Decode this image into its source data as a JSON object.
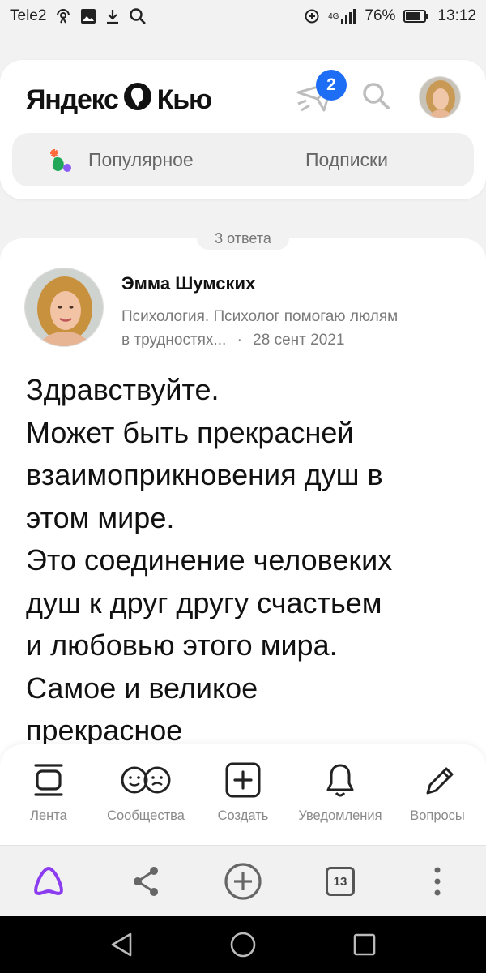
{
  "status_bar": {
    "carrier": "Tele2",
    "network": "4G",
    "battery": "76%",
    "time": "13:12",
    "icons": [
      "radio-icon",
      "image-icon",
      "download-icon",
      "search-icon",
      "data-saver-icon",
      "signal-icon",
      "battery-icon"
    ]
  },
  "header": {
    "logo_left": "Яндекс",
    "logo_right": "Кью",
    "notifications_count": "2",
    "tabs": [
      {
        "label": "Популярное",
        "icon": "flame-icon"
      },
      {
        "label": "Подписки"
      }
    ]
  },
  "answer": {
    "answers_count": "3 ответа",
    "author": {
      "name": "Эмма Шумских",
      "bio": "Психология. Психолог помогаю люлям",
      "bio_cont": "в трудностях...",
      "separator": "·",
      "date": "28 сент 2021"
    },
    "text_lines": [
      "Здравствуйте.",
      "Может быть прекрасней",
      "взаимоприкновения душ в",
      "этом мире.",
      "Это соединение человеких",
      "душ к друг другу счастьем",
      "и любовью этого мира.",
      "Самое и великое",
      "прекрасное"
    ]
  },
  "bottom_nav": {
    "items": [
      {
        "label": "Лента",
        "icon": "feed-icon"
      },
      {
        "label": "Сообщества",
        "icon": "communities-icon"
      },
      {
        "label": "Создать",
        "icon": "create-icon"
      },
      {
        "label": "Уведомления",
        "icon": "bell-icon"
      },
      {
        "label": "Вопросы",
        "icon": "pencil-icon"
      }
    ]
  },
  "browser_bar": {
    "tabs_count": "13",
    "icons": [
      "alice-icon",
      "share-icon",
      "new-tab-icon",
      "tabs-icon",
      "more-icon"
    ]
  },
  "colors": {
    "accent_blue": "#1e6ef5",
    "alice_purple": "#8c3cf0",
    "tab_bg": "#f0f0f0"
  }
}
